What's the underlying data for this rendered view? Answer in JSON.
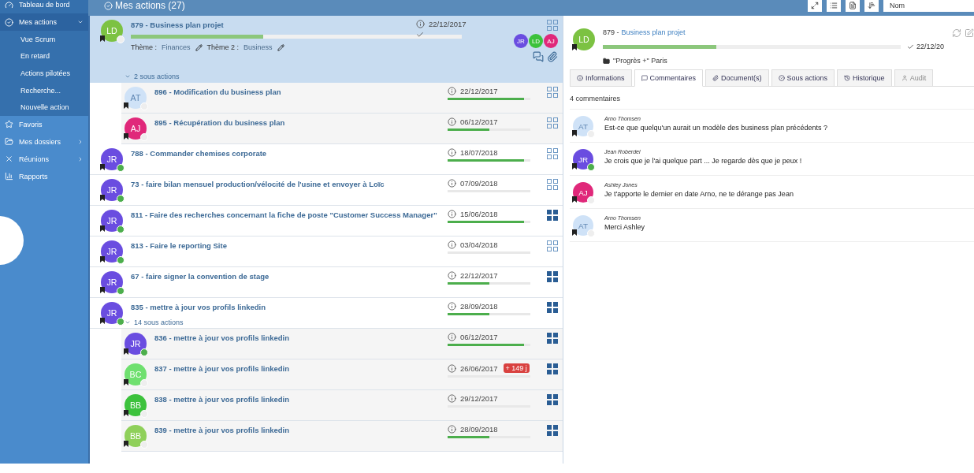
{
  "sidebar": {
    "items": [
      {
        "label": "Tableau de bord",
        "selected": false
      },
      {
        "label": "Mes actions",
        "selected": true,
        "expanded": true,
        "children": [
          {
            "label": "Vue Scrum"
          },
          {
            "label": "En retard"
          },
          {
            "label": "Actions pilotées"
          },
          {
            "label": "Recherche..."
          },
          {
            "label": "Nouvelle action"
          }
        ]
      },
      {
        "label": "Favoris",
        "selected": false
      },
      {
        "label": "Mes dossiers",
        "selected": false,
        "expanded": false
      },
      {
        "label": "Réunions",
        "selected": false,
        "expanded": false
      },
      {
        "label": "Rapports",
        "selected": false
      }
    ]
  },
  "toolbar": {
    "title": "Mes actions (27)",
    "sort_field": "Nom"
  },
  "actions": [
    {
      "title": "879 - Business plan projet",
      "date": "22/12/2017",
      "level": 0.4,
      "avatar": "LD",
      "color": "#7cc242",
      "online": false,
      "filled": false,
      "selected": true,
      "themes": [
        {
          "label": "Thème :",
          "value": "Finances"
        },
        {
          "label": "Thème 2 :",
          "value": "Business"
        }
      ],
      "participants": [
        {
          "initials": "JR",
          "color": "#6a4de0"
        },
        {
          "initials": "LD",
          "color": "#3cc23c"
        },
        {
          "initials": "AJ",
          "color": "#e0287a"
        }
      ],
      "sub_count": "2 sous actions",
      "children": [
        {
          "title": "896 - Modification du business plan",
          "date": "22/12/2017",
          "level": 0.92,
          "avatar": "AT",
          "color": "#cfe2f7",
          "online": false,
          "filled": false
        },
        {
          "title": "895 - Récupération du business plan",
          "date": "06/12/2017",
          "level": 0.5,
          "avatar": "AJ",
          "color": "#e0287a",
          "online": false,
          "filled": false
        }
      ]
    },
    {
      "title": "788 - Commander chemises corporate",
      "date": "18/07/2018",
      "level": 0.92,
      "avatar": "JR",
      "color": "#6a4de0",
      "online": true,
      "filled": false,
      "selected": false
    },
    {
      "title": "73 - faire bilan mensuel production/vélocité de l'usine et envoyer à Loïc",
      "date": "07/09/2018",
      "level": 0,
      "avatar": "JR",
      "color": "#6a4de0",
      "online": true,
      "filled": false,
      "selected": false
    },
    {
      "title": "811 - Faire des recherches concernant la fiche de poste \"Customer Success Manager\"",
      "date": "15/06/2018",
      "level": 0.92,
      "avatar": "JR",
      "color": "#6a4de0",
      "online": true,
      "filled": true,
      "selected": false
    },
    {
      "title": "813 - Faire le reporting Site",
      "date": "03/04/2018",
      "level": 0,
      "avatar": "JR",
      "color": "#6a4de0",
      "online": true,
      "filled": false,
      "selected": false
    },
    {
      "title": "67 - faire signer la convention de stage",
      "date": "22/12/2017",
      "level": 0.5,
      "avatar": "JR",
      "color": "#6a4de0",
      "online": true,
      "filled": true,
      "selected": false
    },
    {
      "title": "835 - mettre à jour vos profils linkedin",
      "date": "28/09/2018",
      "level": 0.5,
      "avatar": "JR",
      "color": "#6a4de0",
      "online": true,
      "filled": true,
      "selected": false,
      "sub_count": "14 sous actions",
      "children": [
        {
          "title": "836 - mettre à jour vos profils linkedin",
          "date": "06/12/2017",
          "level": 0.92,
          "avatar": "JR",
          "color": "#6a4de0",
          "online": true,
          "filled": true
        },
        {
          "title": "837 - mettre à jour vos profils linkedin",
          "date": "26/06/2017",
          "late": "+ 149 j",
          "level": 0,
          "avatar": "BC",
          "color": "#6fe06f",
          "online": false,
          "filled": true
        },
        {
          "title": "838 - mettre à jour vos profils linkedin",
          "date": "29/12/2017",
          "level": 0,
          "avatar": "BB",
          "color": "#3cc23c",
          "online": false,
          "filled": true
        },
        {
          "title": "839 - mettre à jour vos profils linkedin",
          "date": "28/09/2018",
          "level": 0.5,
          "avatar": "BB",
          "color": "#8fd05a",
          "online": false,
          "filled": true
        }
      ]
    }
  ],
  "detail": {
    "number": "879 -",
    "name": "Business plan projet",
    "avatar": "LD",
    "color": "#7cc242",
    "level": 0.38,
    "date": "22/12/20",
    "folder": "\"Progrès +\" Paris",
    "tabs": [
      {
        "label": "Informations",
        "selected": false,
        "disabled": false
      },
      {
        "label": "Commentaires",
        "selected": true,
        "disabled": false
      },
      {
        "label": "Document(s)",
        "selected": false,
        "disabled": false
      },
      {
        "label": "Sous actions",
        "selected": false,
        "disabled": false
      },
      {
        "label": "Historique",
        "selected": false,
        "disabled": false
      },
      {
        "label": "Audit",
        "selected": false,
        "disabled": true
      }
    ],
    "comment_count": "4 commentaires",
    "comments": [
      {
        "author": "Arno Thomsen",
        "text": "Est-ce que quelqu'un aurait un modèle des business plan précédents ?",
        "avatar": "AT",
        "color": "#cfe2f7",
        "online": false
      },
      {
        "author": "Jean Roberdel",
        "text": "Je crois que je l'ai quelque part ... Je regarde dès que je peux !",
        "avatar": "JR",
        "color": "#6a4de0",
        "online": true
      },
      {
        "author": "Ashley Jones",
        "text": "Je t'apporte le dernier en date Arno, ne te dérange pas Jean",
        "avatar": "AJ",
        "color": "#e0287a",
        "online": false
      },
      {
        "author": "Arno Thomsen",
        "text": "Merci Ashley",
        "avatar": "AT",
        "color": "#cfe2f7",
        "online": false
      }
    ]
  }
}
